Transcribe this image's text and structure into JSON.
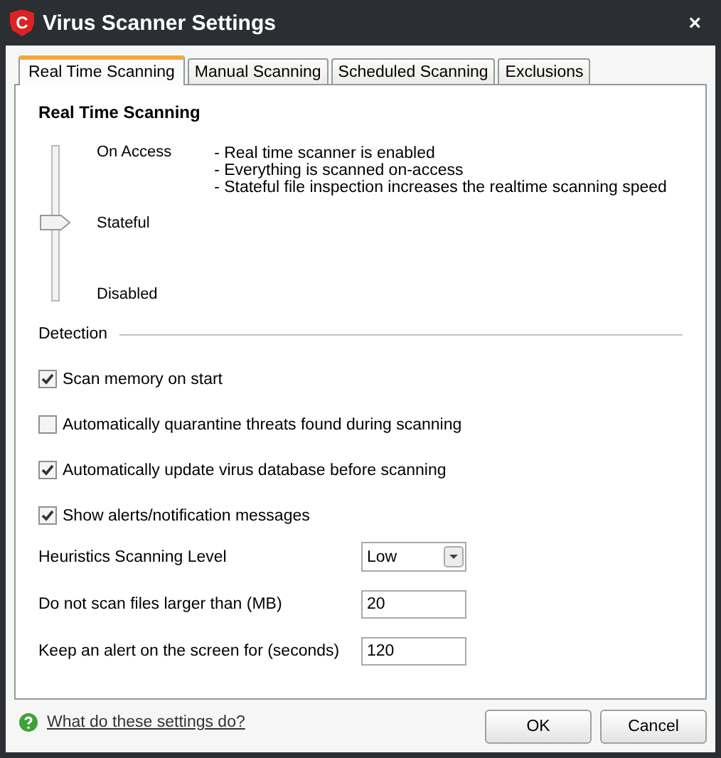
{
  "window": {
    "title": "Virus Scanner Settings",
    "close": "×",
    "logo": "C"
  },
  "tabs": [
    {
      "label": "Real Time Scanning",
      "selected": true
    },
    {
      "label": "Manual Scanning",
      "selected": false
    },
    {
      "label": "Scheduled Scanning",
      "selected": false
    },
    {
      "label": "Exclusions",
      "selected": false
    }
  ],
  "section_title": "Real Time Scanning",
  "slider": {
    "level": 0.5,
    "stops": [
      "On Access",
      "Stateful",
      "Disabled"
    ],
    "description": [
      "- Real time scanner is enabled",
      "- Everything is scanned on-access",
      "- Stateful file inspection increases the realtime scanning speed"
    ]
  },
  "detection": {
    "title": "Detection",
    "options": [
      {
        "label": "Scan memory on start",
        "checked": true
      },
      {
        "label": "Automatically quarantine threats found during scanning",
        "checked": false
      },
      {
        "label": "Automatically update virus database before scanning",
        "checked": true
      },
      {
        "label": "Show alerts/notification messages",
        "checked": true
      }
    ]
  },
  "settings": [
    {
      "label": "Heuristics Scanning Level",
      "kind": "dropdown",
      "value": "Low"
    },
    {
      "label": "Do not scan files larger than (MB)",
      "kind": "input",
      "value": "20"
    },
    {
      "label": "Keep an alert on the screen for (seconds)",
      "kind": "input",
      "value": "120"
    }
  ],
  "help_link": "What do these settings do?",
  "buttons": [
    "OK",
    "Cancel"
  ]
}
